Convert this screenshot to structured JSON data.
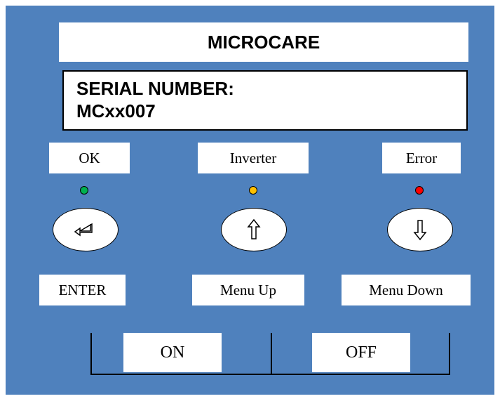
{
  "header": {
    "title": "MICROCARE"
  },
  "display": {
    "line1": "SERIAL NUMBER:",
    "line2": "MCxx007"
  },
  "indicators": [
    {
      "label": "OK",
      "color": "#00b050"
    },
    {
      "label": "Inverter",
      "color": "#ffc000"
    },
    {
      "label": "Error",
      "color": "#ff0000"
    }
  ],
  "buttons": [
    {
      "label": "ENTER",
      "icon": "enter-return-icon"
    },
    {
      "label": "Menu Up",
      "icon": "arrow-up-icon"
    },
    {
      "label": "Menu Down",
      "icon": "arrow-down-icon"
    }
  ],
  "power": {
    "on_label": "ON",
    "off_label": "OFF"
  }
}
